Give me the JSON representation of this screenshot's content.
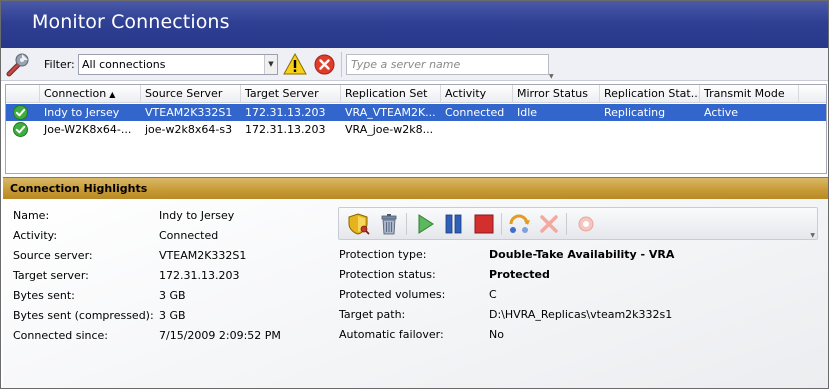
{
  "window": {
    "title": "Monitor Connections"
  },
  "toolbar": {
    "wrench_icon": "wrench-icon",
    "filter_label": "Filter:",
    "filter_value": "All connections",
    "warning_icon": "warning-icon",
    "error_icon": "error-icon",
    "search_placeholder": "Type a server name"
  },
  "grid": {
    "columns": [
      "",
      "Connection",
      "Source Server",
      "Target Server",
      "Replication Set",
      "Activity",
      "Mirror Status",
      "Replication Stat...",
      "Transmit Mode"
    ],
    "sort_column": "Connection",
    "sort_indicator": "▲",
    "rows": [
      {
        "status_icon": "check-icon",
        "connection": "Indy to Jersey",
        "source": "VTEAM2K332S1",
        "target": "172.31.13.203",
        "repset": "VRA_VTEAM2K...",
        "activity": "Connected",
        "mirror": "Idle",
        "replication": "Replicating",
        "transmit": "Active",
        "selected": true
      },
      {
        "status_icon": "check-icon",
        "connection": "Joe-W2K8x64-...",
        "source": "joe-w2k8x64-s3",
        "target": "172.31.13.203",
        "repset": "VRA_joe-w2k8...",
        "activity": "",
        "mirror": "",
        "replication": "",
        "transmit": "",
        "selected": false
      }
    ]
  },
  "highlights": {
    "header": "Connection Highlights",
    "left": [
      {
        "label": "Name:",
        "value": "Indy to Jersey"
      },
      {
        "label": "Activity:",
        "value": "Connected"
      },
      {
        "label": "Source server:",
        "value": "VTEAM2K332S1"
      },
      {
        "label": "Target server:",
        "value": "172.31.13.203"
      },
      {
        "label": "Bytes sent:",
        "value": "3 GB"
      },
      {
        "label": "Bytes sent (compressed):",
        "value": "3 GB"
      },
      {
        "label": "Connected since:",
        "value": "7/15/2009 2:09:52 PM"
      }
    ],
    "right": [
      {
        "label": "Protection type:",
        "value": "Double-Take Availability - VRA",
        "bold": true
      },
      {
        "label": "Protection status:",
        "value": "Protected",
        "bold": true
      },
      {
        "label": "Protected volumes:",
        "value": "C"
      },
      {
        "label": "Target path:",
        "value": "D:\\HVRA_Replicas\\vteam2k332s1"
      },
      {
        "label": "Automatic failover:",
        "value": "No"
      }
    ],
    "actions": [
      "shield-key-icon",
      "trash-icon",
      "play-icon",
      "pause-icon",
      "stop-icon",
      "failover-icon",
      "disconnect-icon",
      "record-icon"
    ]
  }
}
